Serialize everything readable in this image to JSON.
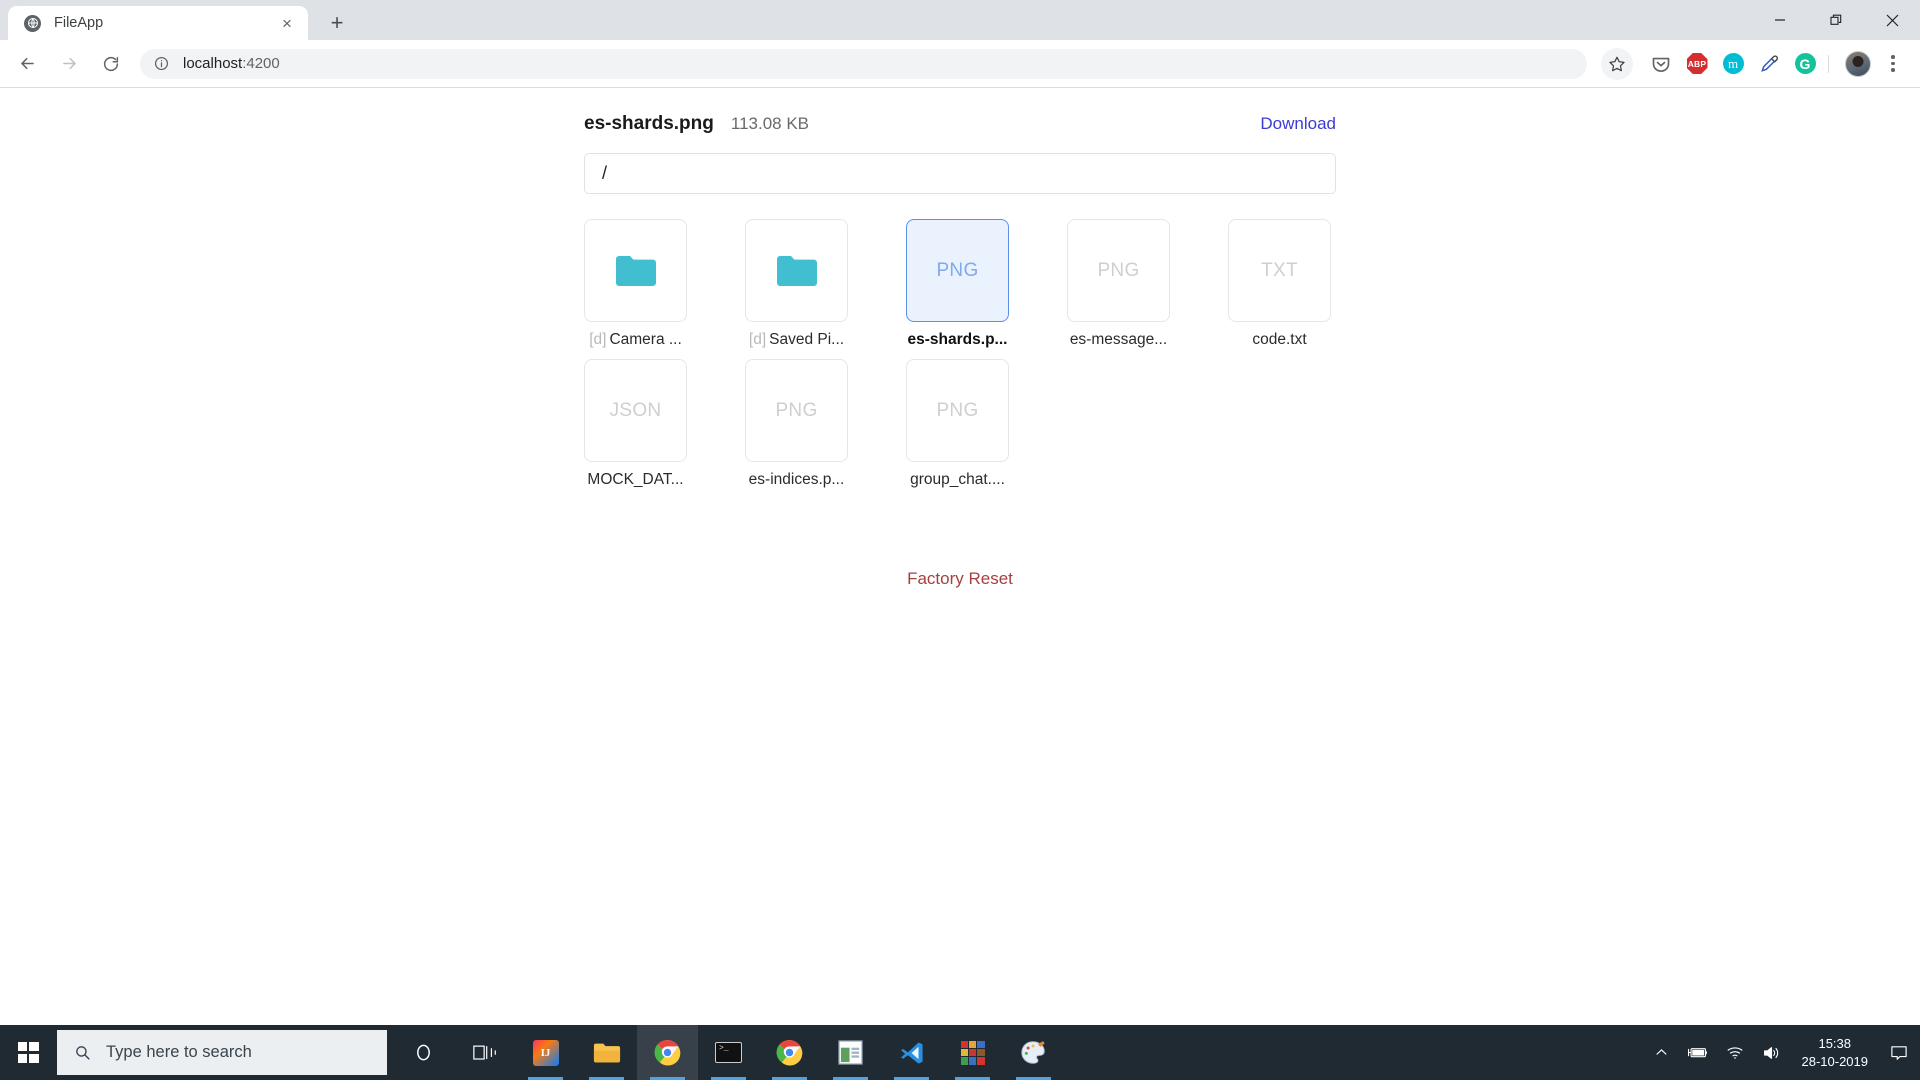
{
  "browser": {
    "tab": {
      "title": "FileApp",
      "favicon": "globe-icon",
      "close_label": "×"
    },
    "new_tab_label": "+",
    "window_controls": {
      "minimize": "minimize-icon",
      "maximize": "restore-icon",
      "close": "close-icon"
    },
    "nav": {
      "back": "back-arrow-icon",
      "forward": "forward-arrow-icon",
      "reload": "reload-icon"
    },
    "omnibox": {
      "info_icon": "info-circle-icon",
      "host": "localhost",
      "port": ":4200"
    },
    "extensions": [
      {
        "name": "bookmark-star-icon",
        "label": ""
      },
      {
        "name": "pocket-icon",
        "label": ""
      },
      {
        "name": "adblock-plus-icon",
        "label": "ABP"
      },
      {
        "name": "momentum-icon",
        "label": "m"
      },
      {
        "name": "colorzilla-eyedropper-icon",
        "label": ""
      },
      {
        "name": "grammarly-icon",
        "label": "G"
      }
    ],
    "profile_avatar": "avatar",
    "menu": "kebab-menu-icon"
  },
  "app": {
    "file_header": {
      "filename": "es-shards.png",
      "filesize": "113.08 KB",
      "download_label": "Download"
    },
    "path_input": {
      "value": "/",
      "placeholder": "/"
    },
    "files": [
      {
        "type": "folder",
        "ext": "",
        "prefix": "[d]",
        "label": "Camera ...",
        "selected": false
      },
      {
        "type": "folder",
        "ext": "",
        "prefix": "[d]",
        "label": "Saved Pi...",
        "selected": false
      },
      {
        "type": "file",
        "ext": "PNG",
        "prefix": "",
        "label": "es-shards.p...",
        "selected": true
      },
      {
        "type": "file",
        "ext": "PNG",
        "prefix": "",
        "label": "es-message...",
        "selected": false
      },
      {
        "type": "file",
        "ext": "TXT",
        "prefix": "",
        "label": "code.txt",
        "selected": false
      },
      {
        "type": "file",
        "ext": "JSON",
        "prefix": "",
        "label": "MOCK_DAT...",
        "selected": false
      },
      {
        "type": "file",
        "ext": "PNG",
        "prefix": "",
        "label": "es-indices.p...",
        "selected": false
      },
      {
        "type": "file",
        "ext": "PNG",
        "prefix": "",
        "label": "group_chat....",
        "selected": false
      }
    ],
    "factory_reset_label": "Factory Reset",
    "colors": {
      "folder": "#41bfd0",
      "selected_bg": "#eaf2fd",
      "selected_border": "#5d8fe8",
      "selected_ext_text": "#7fa9f0",
      "ext_text": "#cfcfcf",
      "download_link": "#3b3bd6",
      "factory_reset": "#a5413f"
    }
  },
  "taskbar": {
    "start": "windows-start-icon",
    "search_placeholder": "Type here to search",
    "apps": [
      {
        "name": "cortana-icon",
        "active": false,
        "running": false
      },
      {
        "name": "task-view-icon",
        "active": false,
        "running": false
      },
      {
        "name": "intellij-idea-icon",
        "active": false,
        "running": true
      },
      {
        "name": "file-explorer-icon",
        "active": false,
        "running": true
      },
      {
        "name": "google-chrome-icon",
        "active": true,
        "running": true
      },
      {
        "name": "terminal-icon",
        "active": false,
        "running": true
      },
      {
        "name": "google-chrome-icon",
        "active": false,
        "running": true
      },
      {
        "name": "window-app-icon",
        "active": false,
        "running": true
      },
      {
        "name": "vs-code-icon",
        "active": false,
        "running": true
      },
      {
        "name": "winrar-icon",
        "active": false,
        "running": true
      },
      {
        "name": "paint-3d-icon",
        "active": false,
        "running": true
      }
    ],
    "tray": {
      "chevron": "show-hidden-icons-icon",
      "battery": "battery-charging-icon",
      "network": "wifi-icon",
      "volume": "volume-icon",
      "time": "15:38",
      "date": "28-10-2019",
      "action_center": "notifications-icon"
    }
  }
}
